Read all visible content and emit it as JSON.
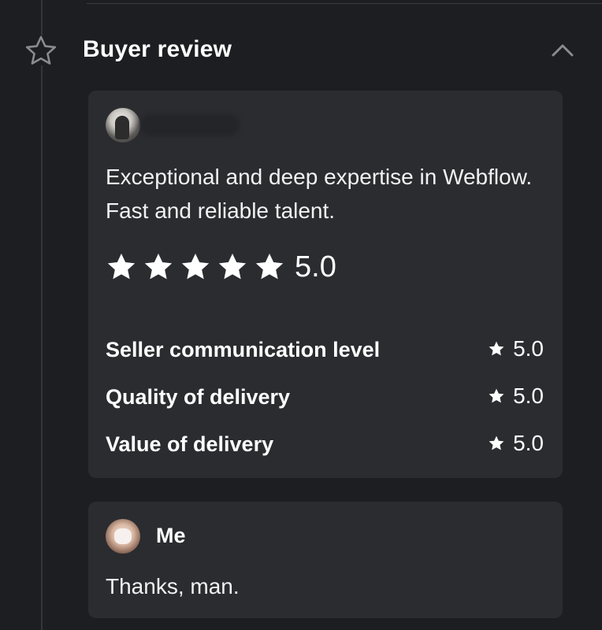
{
  "section": {
    "title": "Buyer review",
    "icon": "star-outline-icon",
    "toggle_icon": "chevron-up-icon"
  },
  "review": {
    "reviewer_avatar": "reviewer-avatar",
    "reviewer_name_blurred": true,
    "text": "Exceptional and deep expertise in Webflow. Fast and reliable talent.",
    "rating": {
      "stars": 5,
      "max": 5,
      "score": "5.0"
    },
    "criteria": [
      {
        "label": "Seller communication level",
        "score": "5.0"
      },
      {
        "label": "Quality of delivery",
        "score": "5.0"
      },
      {
        "label": "Value of delivery",
        "score": "5.0"
      }
    ]
  },
  "reply": {
    "author": "Me",
    "text": "Thanks, man."
  },
  "colors": {
    "background": "#1d1e21",
    "card": "#2b2c30",
    "text": "#f2f2f3",
    "icon_muted": "#8a8b8f"
  }
}
